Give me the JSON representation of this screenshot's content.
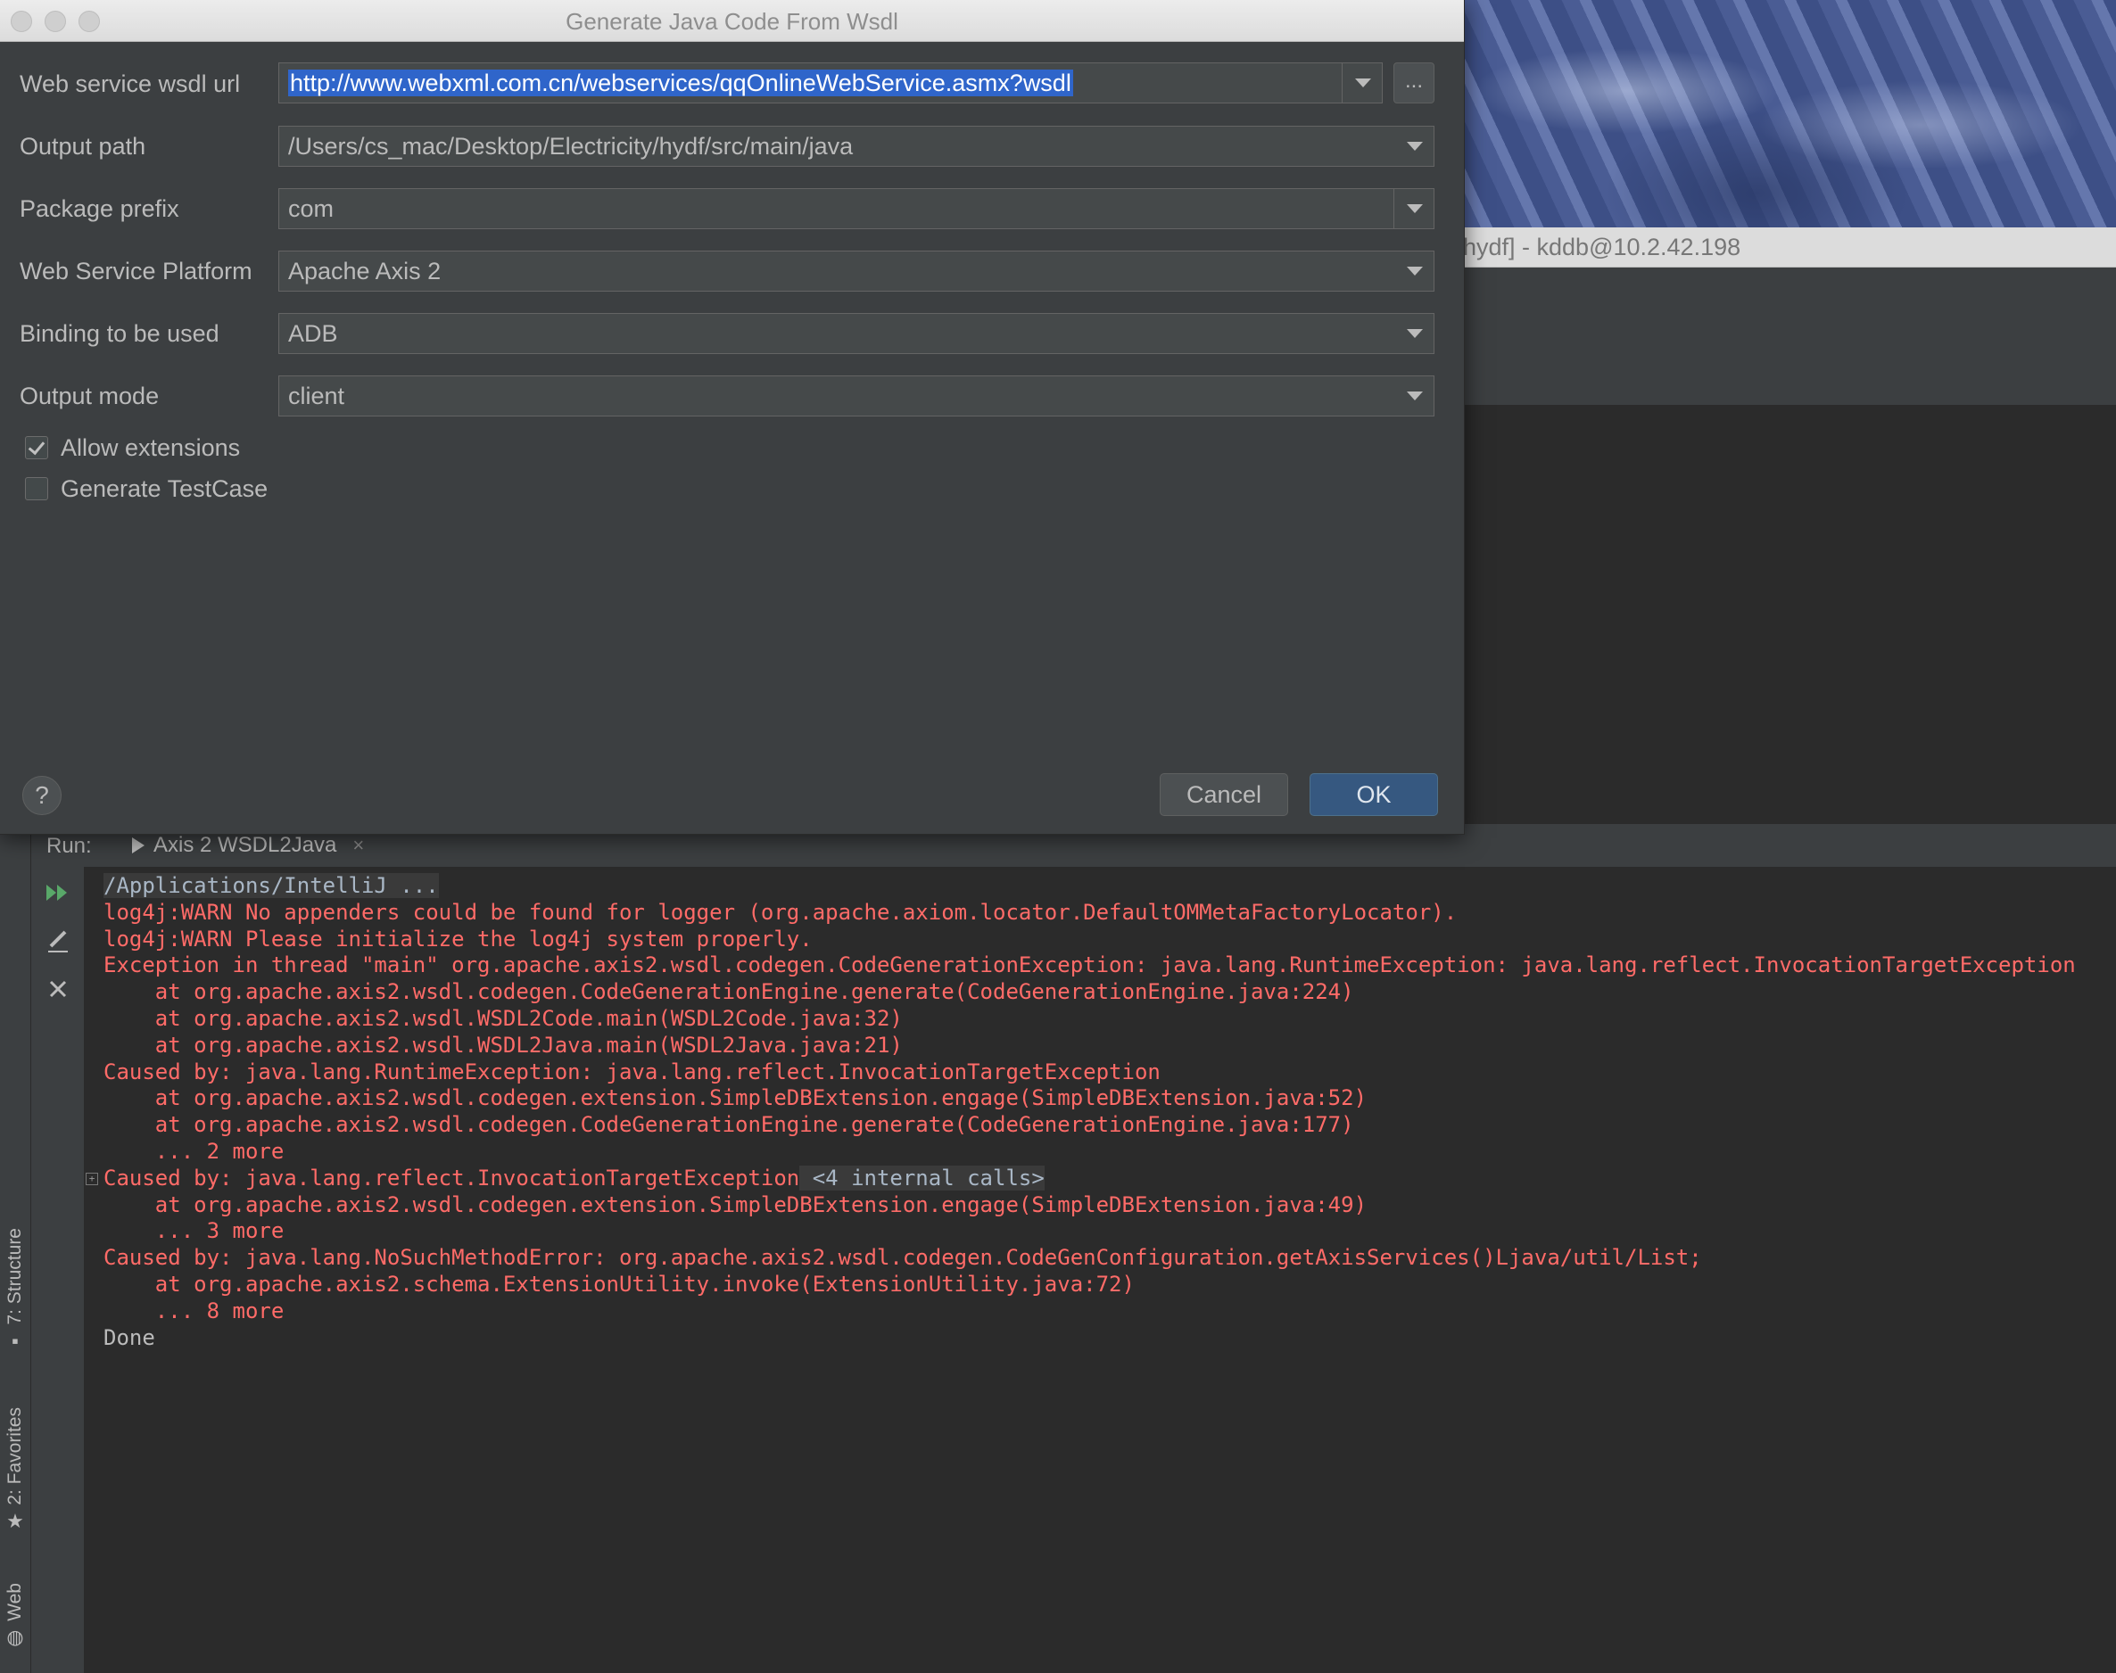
{
  "dialog": {
    "title": "Generate Java Code From Wsdl",
    "fields": {
      "wsdl_url": {
        "label": "Web service wsdl url",
        "value": "http://www.webxml.com.cn/webservices/qqOnlineWebService.asmx?wsdl"
      },
      "output_path": {
        "label": "Output path",
        "value": "/Users/cs_mac/Desktop/Electricity/hydf/src/main/java"
      },
      "package_prefix": {
        "label": "Package prefix",
        "value": "com"
      },
      "platform": {
        "label": "Web Service Platform",
        "value": "Apache Axis 2"
      },
      "binding": {
        "label": "Binding to be used",
        "value": "ADB"
      },
      "output_mode": {
        "label": "Output mode",
        "value": "client"
      }
    },
    "browse_label": "...",
    "allow_extensions": {
      "label": "Allow extensions",
      "checked": true
    },
    "generate_testcase": {
      "label": "Generate TestCase",
      "checked": false
    },
    "help_label": "?",
    "cancel_label": "Cancel",
    "ok_label": "OK"
  },
  "background_window": {
    "title": "hydf] - kddb@10.2.42.198"
  },
  "run_panel": {
    "label": "Run:",
    "tab_label": "Axis 2 WSDL2Java",
    "console": [
      {
        "text": "/Applications/IntelliJ ...",
        "style": "cmd"
      },
      {
        "text": "log4j:WARN No appenders could be found for logger (org.apache.axiom.locator.DefaultOMMetaFactoryLocator).",
        "style": "red"
      },
      {
        "text": "log4j:WARN Please initialize the log4j system properly.",
        "style": "red"
      },
      {
        "text": "Exception in thread \"main\" org.apache.axis2.wsdl.codegen.CodeGenerationException: java.lang.RuntimeException: java.lang.reflect.InvocationTargetException",
        "style": "red"
      },
      {
        "text": "    at org.apache.axis2.wsdl.codegen.CodeGenerationEngine.generate(CodeGenerationEngine.java:224)",
        "style": "red"
      },
      {
        "text": "    at org.apache.axis2.wsdl.WSDL2Code.main(WSDL2Code.java:32)",
        "style": "red"
      },
      {
        "text": "    at org.apache.axis2.wsdl.WSDL2Java.main(WSDL2Java.java:21)",
        "style": "red"
      },
      {
        "text": "Caused by: java.lang.RuntimeException: java.lang.reflect.InvocationTargetException",
        "style": "red"
      },
      {
        "text": "    at org.apache.axis2.wsdl.codegen.extension.SimpleDBExtension.engage(SimpleDBExtension.java:52)",
        "style": "red"
      },
      {
        "text": "    at org.apache.axis2.wsdl.codegen.CodeGenerationEngine.generate(CodeGenerationEngine.java:177)",
        "style": "red"
      },
      {
        "text": "    ... 2 more",
        "style": "red"
      },
      {
        "text": "Caused by: java.lang.reflect.InvocationTargetException",
        "style": "red",
        "fold": " <4 internal calls>"
      },
      {
        "text": "    at org.apache.axis2.wsdl.codegen.extension.SimpleDBExtension.engage(SimpleDBExtension.java:49)",
        "style": "red"
      },
      {
        "text": "    ... 3 more",
        "style": "red"
      },
      {
        "text": "Caused by: java.lang.NoSuchMethodError: org.apache.axis2.wsdl.codegen.CodeGenConfiguration.getAxisServices()Ljava/util/List;",
        "style": "red"
      },
      {
        "text": "    at org.apache.axis2.schema.ExtensionUtility.invoke(ExtensionUtility.java:72)",
        "style": "red"
      },
      {
        "text": "    ... 8 more",
        "style": "red"
      },
      {
        "text": "Done",
        "style": "gray"
      }
    ]
  },
  "side_tabs": {
    "structure": "7: Structure",
    "favorites": "2: Favorites",
    "web": "Web"
  },
  "colors": {
    "dialog_bg": "#3c3f41",
    "console_bg": "#2b2b2b",
    "error_red": "#ff6b68",
    "selection_blue": "#2f65ca",
    "ok_button": "#365880",
    "run_green": "#59a869"
  },
  "icons": [
    "run-rerun-icon",
    "edit-icon",
    "close-icon",
    "structure-icon",
    "star-icon",
    "globe-icon",
    "play-icon",
    "chevron-down-icon"
  ]
}
